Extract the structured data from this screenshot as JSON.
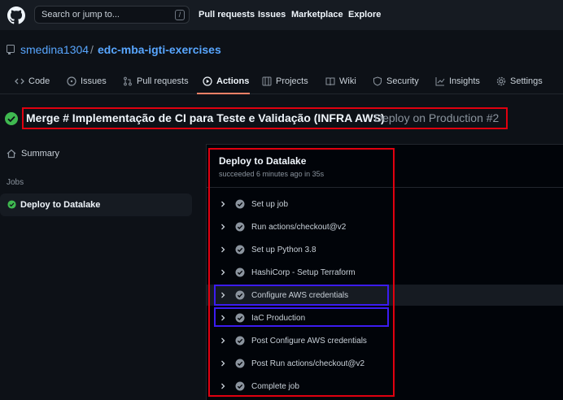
{
  "topbar": {
    "search_placeholder": "Search or jump to...",
    "search_shortcut": "/",
    "nav": [
      "Pull requests",
      "Issues",
      "Marketplace",
      "Explore"
    ]
  },
  "repo": {
    "owner": "smedina1304",
    "separator": "/",
    "name": "edc-mba-igti-exercises"
  },
  "tabs": [
    {
      "label": "Code",
      "icon": "code-icon"
    },
    {
      "label": "Issues",
      "icon": "issue-icon"
    },
    {
      "label": "Pull requests",
      "icon": "pull-request-icon"
    },
    {
      "label": "Actions",
      "icon": "play-icon",
      "active": true
    },
    {
      "label": "Projects",
      "icon": "table-icon"
    },
    {
      "label": "Wiki",
      "icon": "book-icon"
    },
    {
      "label": "Security",
      "icon": "shield-icon"
    },
    {
      "label": "Insights",
      "icon": "graph-icon"
    },
    {
      "label": "Settings",
      "icon": "gear-icon"
    }
  ],
  "run": {
    "title": "Merge # Implementação de CI para Teste e Validação (INFRA AWS)",
    "subtitle": "Deploy on Production #2",
    "status": "success"
  },
  "sidebar": {
    "summary_label": "Summary",
    "jobs_heading": "Jobs",
    "jobs": [
      {
        "label": "Deploy to Datalake",
        "status": "success"
      }
    ]
  },
  "job": {
    "title": "Deploy to Datalake",
    "subtitle": "succeeded 6 minutes ago in 35s",
    "steps": [
      {
        "label": "Set up job"
      },
      {
        "label": "Run actions/checkout@v2"
      },
      {
        "label": "Set up Python 3.8"
      },
      {
        "label": "HashiCorp - Setup Terraform"
      },
      {
        "label": "Configure AWS credentials"
      },
      {
        "label": "IaC Production"
      },
      {
        "label": "Post Configure AWS credentials"
      },
      {
        "label": "Post Run actions/checkout@v2"
      },
      {
        "label": "Complete job"
      }
    ]
  },
  "colors": {
    "background": "#0d1117",
    "success": "#3fb950",
    "link": "#58a6ff",
    "annotation_red": "#e0000f",
    "annotation_blue": "#3b1cf0"
  }
}
